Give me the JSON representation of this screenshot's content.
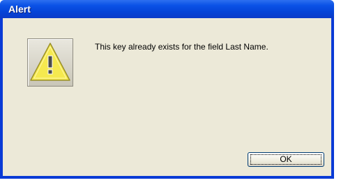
{
  "window": {
    "title": "Alert"
  },
  "alert": {
    "icon": "warning-icon",
    "message": "This key already exists for the field Last Name."
  },
  "buttons": {
    "ok_label": "OK"
  },
  "colors": {
    "titlebar": "#0b52e6",
    "client_bg": "#ece9d8",
    "warning_fill": "#f5e94f"
  }
}
